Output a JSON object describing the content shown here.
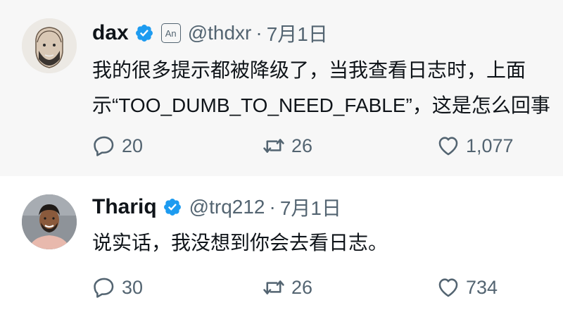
{
  "tweets": [
    {
      "display_name": "dax",
      "badge": "An",
      "handle": "@thdxr",
      "separator": "·",
      "date": "7月1日",
      "text_lines": [
        "我的很多提示都被降级了，当我查看日志时，上面",
        "示“TOO_DUMB_TO_NEED_FABLE”，这是怎么回事"
      ],
      "replies": "20",
      "retweets": "26",
      "likes": "1,077",
      "verified_color": "#1d9bf0"
    },
    {
      "display_name": "Thariq",
      "handle": "@trq212",
      "separator": "·",
      "date": "7月1日",
      "text_lines": [
        "说实话，我没想到你会去看日志。"
      ],
      "replies": "30",
      "retweets": "26",
      "likes": "734",
      "verified_color": "#1d9bf0"
    }
  ],
  "icons": {
    "reply": "reply-icon",
    "retweet": "retweet-icon",
    "like": "heart-icon",
    "verified": "verified-badge-icon"
  }
}
